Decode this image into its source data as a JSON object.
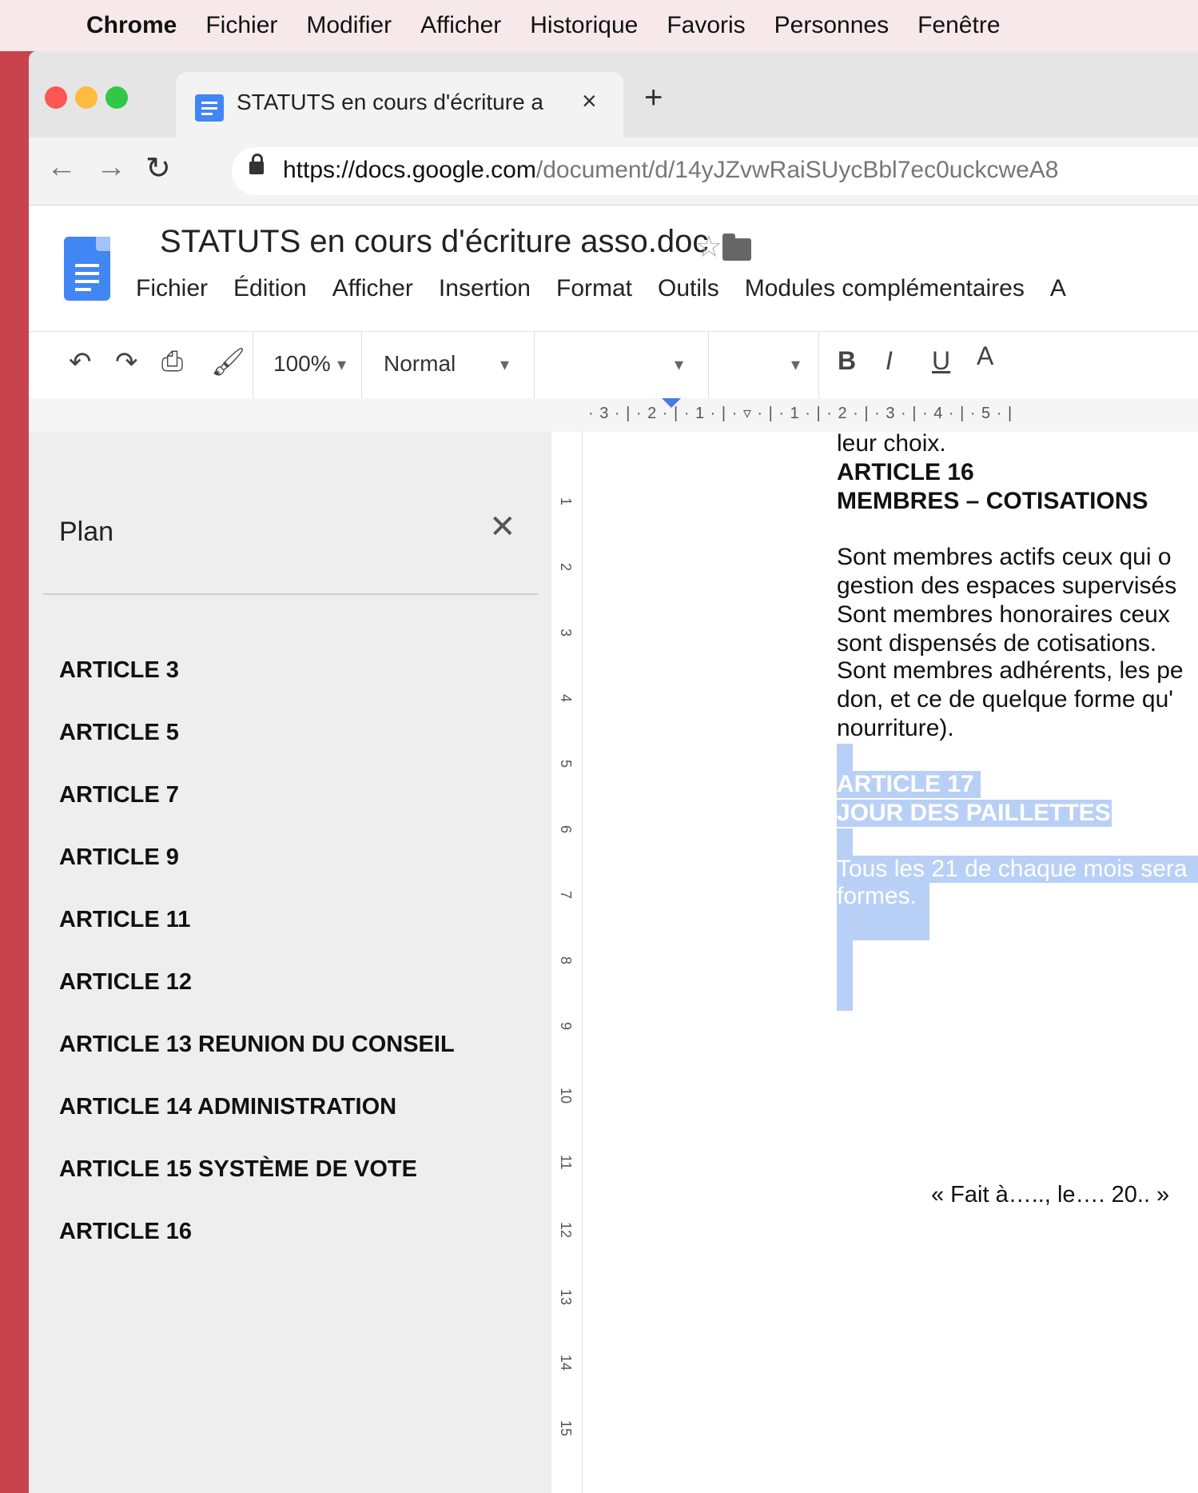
{
  "menubar": {
    "app": "Chrome",
    "items": [
      "Fichier",
      "Modifier",
      "Afficher",
      "Historique",
      "Favoris",
      "Personnes",
      "Fenêtre"
    ]
  },
  "browser": {
    "tab_title": "STATUTS en cours d'écriture a",
    "new_tab": "+",
    "url_host": "https://docs.google.com",
    "url_path": "/document/d/14yJZvwRaiSUycBbl7ec0uckcweA8"
  },
  "docs": {
    "title": "STATUTS en cours d'écriture asso.doc",
    "menu": [
      "Fichier",
      "Édition",
      "Afficher",
      "Insertion",
      "Format",
      "Outils",
      "Modules complémentaires",
      "A"
    ],
    "zoom": "100%",
    "style": "Normal",
    "bold": "B",
    "italic": "I",
    "underline": "U",
    "text_color": "A"
  },
  "ruler": {
    "scale": "· 3 · | · 2 · | · 1 · | · ▿ · | · 1 · | · 2 · | · 3 · | · 4 · | · 5 · |"
  },
  "outline": {
    "title": "Plan",
    "items": [
      "ARTICLE 3",
      "ARTICLE 5",
      "ARTICLE 7",
      "ARTICLE 9",
      "ARTICLE 11",
      "ARTICLE 12",
      "ARTICLE 13 REUNION DU CONSEIL",
      "ARTICLE 14 ADMINISTRATION",
      "ARTICLE 15 SYSTÈME DE VOTE",
      "ARTICLE 16"
    ]
  },
  "vruler_numbers": [
    "1",
    "2",
    "3",
    "4",
    "5",
    "6",
    "7",
    "8",
    "9",
    "10",
    "11",
    "12",
    "13",
    "14",
    "15"
  ],
  "document": {
    "line_top": "leur choix.",
    "article16_title": "ARTICLE 16",
    "article16_subtitle": "MEMBRES – COTISATIONS",
    "body_lines": [
      "Sont membres actifs ceux qui o",
      "gestion des espaces supervisés",
      "Sont membres honoraires ceux",
      "sont dispensés de cotisations.",
      "Sont membres adhérents, les pe",
      "don, et ce de quelque forme qu'",
      "nourriture)."
    ],
    "article17_title": "ARTICLE 17",
    "article17_subtitle": "JOUR DES PAILLETTES",
    "article17_lines": [
      "Tous les 21 de chaque mois sera",
      "formes."
    ],
    "signature": "« Fait à….., le…. 20.. »"
  },
  "colors": {
    "desktop": "#c9434e",
    "selection": "#b9d0f6",
    "docs_blue": "#4285f4"
  }
}
